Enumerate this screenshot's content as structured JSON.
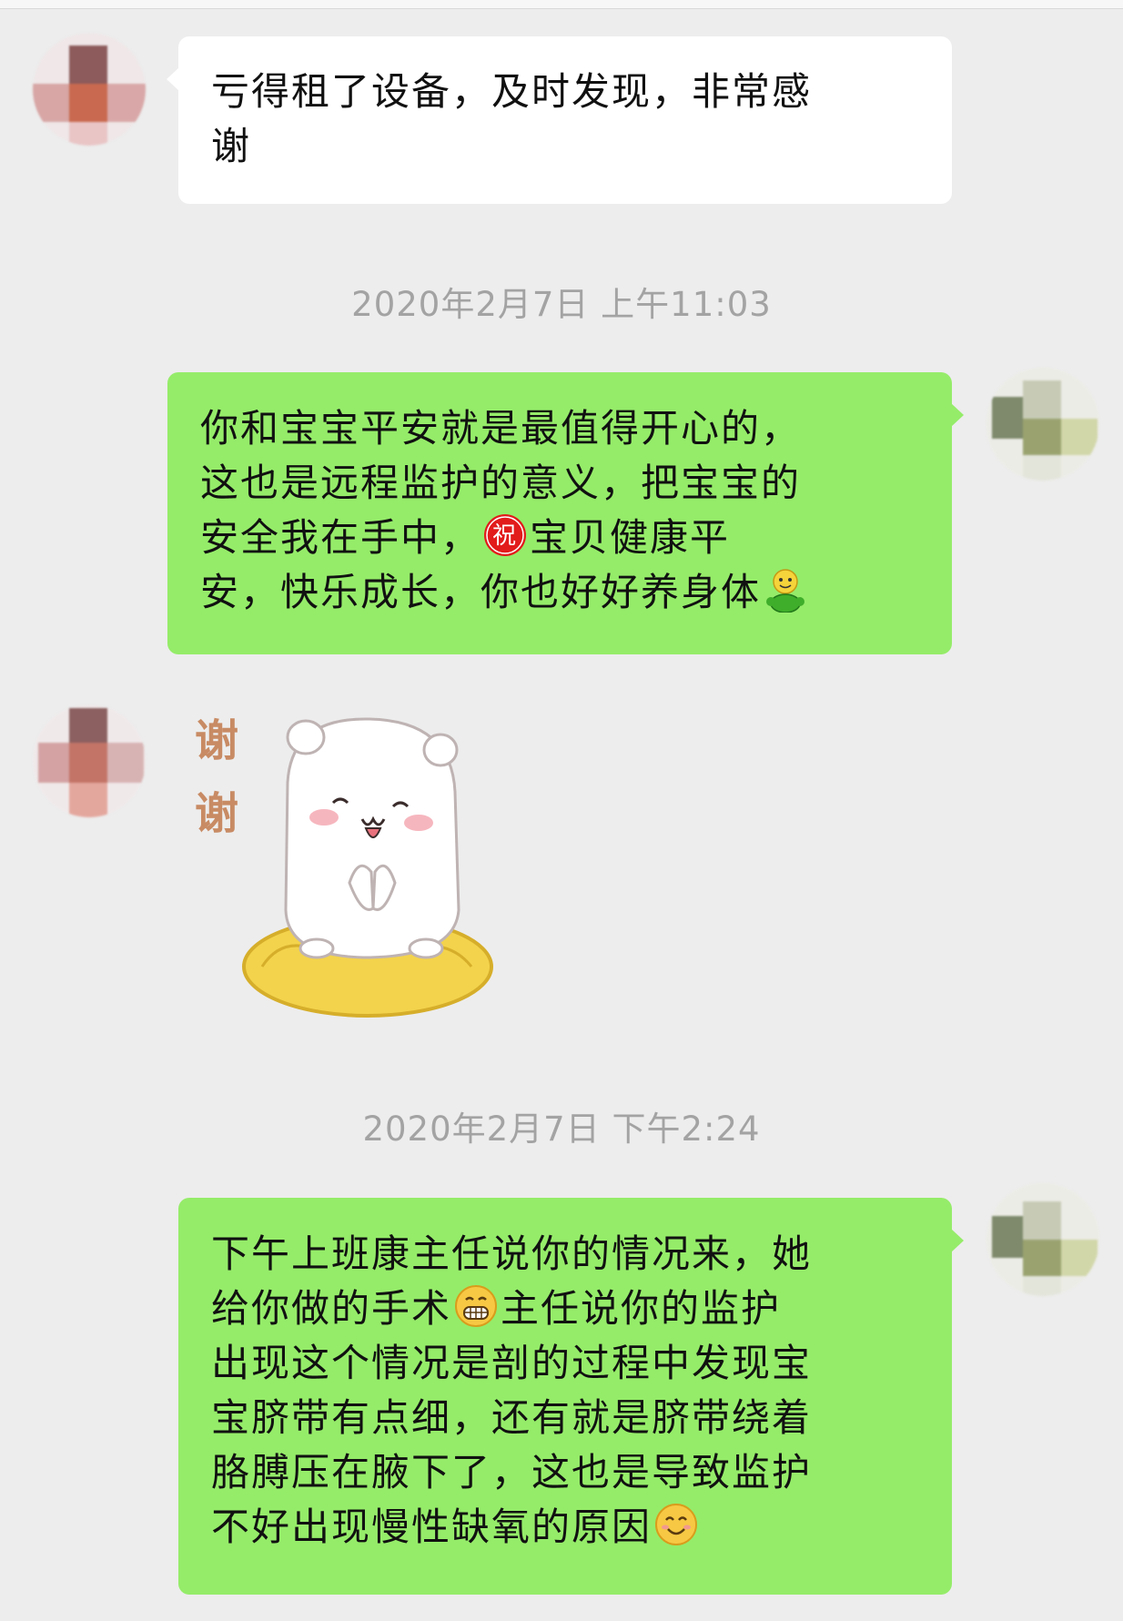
{
  "messages": [
    {
      "side": "in",
      "lines": [
        "亏得租了设备，及时发现，非常感",
        "谢"
      ]
    },
    {
      "timestamp": "2020年2月7日 上午11:03"
    },
    {
      "side": "out",
      "lines": [
        "你和宝宝平安就是最值得开心的，",
        "这也是远程监护的意义，把宝宝的",
        "安全我在手中，",
        "宝贝健康平",
        "安，快乐成长，你也好好养身体"
      ],
      "emoji": [
        "blessing-emoji",
        "person-emoji"
      ]
    },
    {
      "side": "in",
      "sticker": {
        "text": [
          "谢",
          "谢"
        ],
        "name": "bear-thanks-sticker"
      }
    },
    {
      "timestamp": "2020年2月7日 下午2:24"
    },
    {
      "side": "out",
      "lines": [
        "下午上班康主任说你的情况来，她",
        "给你做的手术",
        "主任说你的监护",
        "出现这个情况是剖的过程中发现宝",
        "宝脐带有点细，还有就是脐带绕着",
        "胳膊压在腋下了，这也是导致监护",
        "不好出现慢性缺氧的原因"
      ],
      "emoji": [
        "grin-emoji",
        "smile-emoji"
      ]
    }
  ],
  "emoji_text": {
    "blessing": "祝"
  },
  "colors": {
    "background": "#ededed",
    "outgoing": "#95ec69",
    "incoming": "#ffffff",
    "timestamp": "#a3a3a3"
  }
}
